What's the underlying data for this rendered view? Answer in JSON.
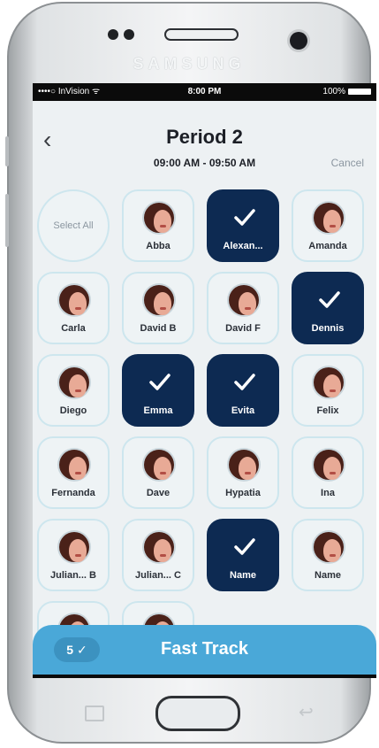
{
  "device": {
    "brand": "SAMSUNG"
  },
  "status_bar": {
    "carrier": "••••○ InVision ᯤ",
    "time": "8:00 PM",
    "battery": "100%"
  },
  "header": {
    "back_icon": "chevron-left-icon",
    "title": "Period 2",
    "time_range": "09:00 AM - 09:50 AM",
    "cancel_label": "Cancel"
  },
  "select_all": {
    "label": "Select All"
  },
  "students": [
    {
      "name": "Abba",
      "selected": false
    },
    {
      "name": "Alexan...",
      "selected": true
    },
    {
      "name": "Amanda",
      "selected": false
    },
    {
      "name": "Carla",
      "selected": false
    },
    {
      "name": "David B",
      "selected": false
    },
    {
      "name": "David F",
      "selected": false
    },
    {
      "name": "Dennis",
      "selected": true
    },
    {
      "name": "Diego",
      "selected": false
    },
    {
      "name": "Emma",
      "selected": true
    },
    {
      "name": "Evita",
      "selected": true
    },
    {
      "name": "Felix",
      "selected": false
    },
    {
      "name": "Fernanda",
      "selected": false
    },
    {
      "name": "Dave",
      "selected": false
    },
    {
      "name": "Hypatia",
      "selected": false
    },
    {
      "name": "Ina",
      "selected": false
    },
    {
      "name": "Julian... B",
      "selected": false
    },
    {
      "name": "Julian... C",
      "selected": false
    },
    {
      "name": "Name",
      "selected": true
    },
    {
      "name": "Name",
      "selected": false
    }
  ],
  "fast_track": {
    "count": "5 ✓",
    "label": "Fast Track"
  },
  "colors": {
    "selected_tile": "#0d2a52",
    "fast_track_bar": "#4aa8d8",
    "tile_border": "#cde6ee"
  }
}
